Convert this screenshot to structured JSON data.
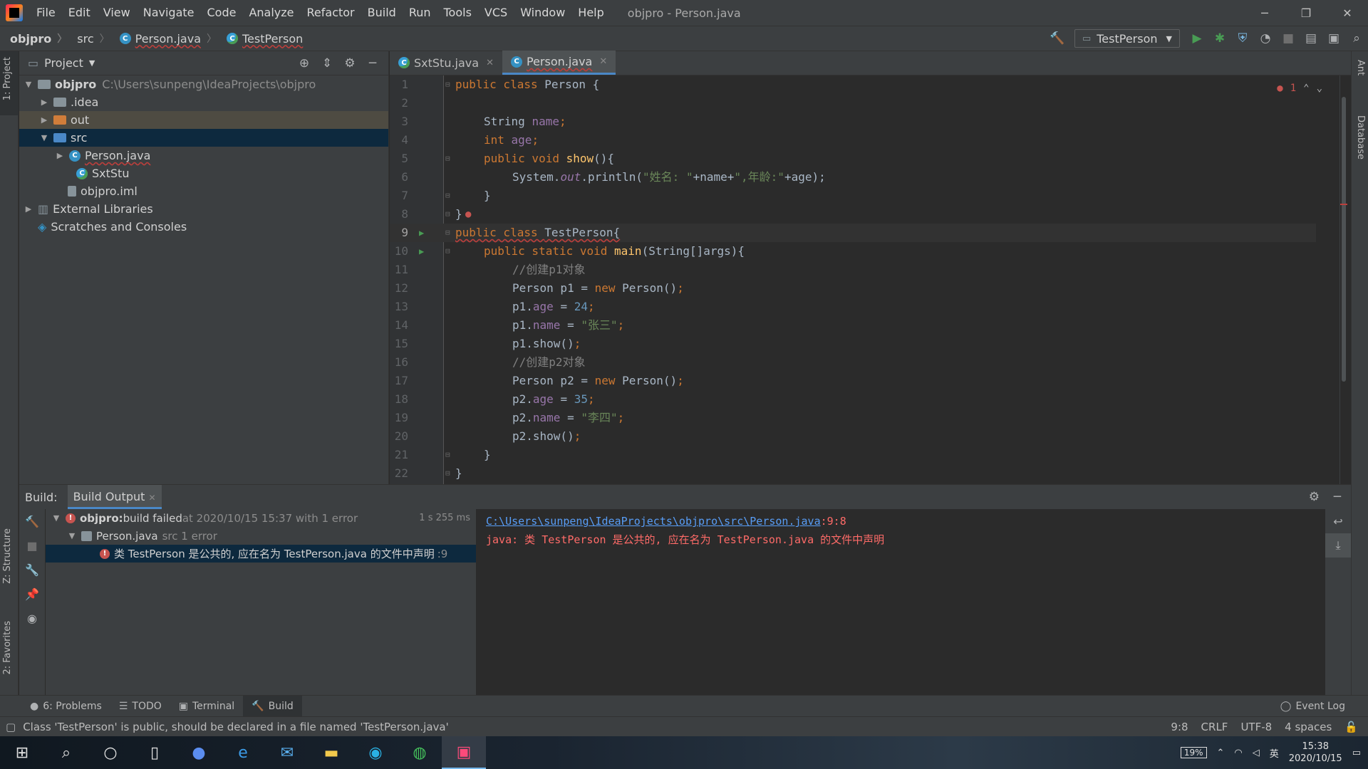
{
  "menu": [
    "File",
    "Edit",
    "View",
    "Navigate",
    "Code",
    "Analyze",
    "Refactor",
    "Build",
    "Run",
    "Tools",
    "VCS",
    "Window",
    "Help"
  ],
  "window_title": "objpro - Person.java",
  "breadcrumbs": [
    "objpro",
    "src",
    "Person.java",
    "TestPerson"
  ],
  "run_config": "TestPerson",
  "project_panel": {
    "title": "Project",
    "tree": [
      {
        "label": "objpro",
        "extra": "C:\\Users\\sunpeng\\IdeaProjects\\objpro"
      },
      {
        "label": ".idea"
      },
      {
        "label": "out"
      },
      {
        "label": "src"
      },
      {
        "label": "Person.java"
      },
      {
        "label": "SxtStu"
      },
      {
        "label": "objpro.iml"
      },
      {
        "label": "External Libraries"
      },
      {
        "label": "Scratches and Consoles"
      }
    ]
  },
  "editor": {
    "tabs": [
      {
        "label": "SxtStu.java"
      },
      {
        "label": "Person.java"
      }
    ],
    "error_count": "1",
    "line_numbers": [
      "1",
      "2",
      "3",
      "4",
      "5",
      "6",
      "7",
      "8",
      "9",
      "10",
      "11",
      "12",
      "13",
      "14",
      "15",
      "16",
      "17",
      "18",
      "19",
      "20",
      "21",
      "22"
    ],
    "code": {
      "l1_kw": "public class ",
      "l1_name": "Person {",
      "l3_type": "String ",
      "l3_field": "name",
      "l3_end": ";",
      "l4_kw": "int ",
      "l4_field": "age",
      "l4_end": ";",
      "l5_kw": "public void ",
      "l5_fn": "show",
      "l5_end": "(){",
      "l6_a": "System.",
      "l6_out": "out",
      "l6_b": ".println(",
      "l6_s1": "\"姓名: \"",
      "l6_c": "+name+",
      "l6_s2": "\",年龄:\"",
      "l6_d": "+age",
      "l6_e": ");",
      "l7": "}",
      "l8": "}",
      "l9_kw": "public class ",
      "l9_name": "TestPerson{",
      "l10_kw": "public static void ",
      "l10_fn": "main",
      "l10_end": "(String[]args){",
      "l11": "//创建p1对象",
      "l12_a": "Person p1 = ",
      "l12_kw": "new ",
      "l12_b": "Person()",
      "l12_end": ";",
      "l13_a": "p1.",
      "l13_f": "age",
      "l13_b": " = ",
      "l13_n": "24",
      "l13_end": ";",
      "l14_a": "p1.",
      "l14_f": "name",
      "l14_b": " = ",
      "l14_s": "\"张三\"",
      "l14_end": ";",
      "l15": "p1.show()",
      "l15_end": ";",
      "l16": "//创建p2对象",
      "l17_a": "Person p2 = ",
      "l17_kw": "new ",
      "l17_b": "Person()",
      "l17_end": ";",
      "l18_a": "p2.",
      "l18_f": "age",
      "l18_b": " = ",
      "l18_n": "35",
      "l18_end": ";",
      "l19_a": "p2.",
      "l19_f": "name",
      "l19_b": " = ",
      "l19_s": "\"李四\"",
      "l19_end": ";",
      "l20": "p2.show()",
      "l20_end": ";",
      "l21": "}",
      "l22": "}"
    }
  },
  "build": {
    "label": "Build:",
    "tab": "Build Output",
    "root_name": "objpro:",
    "root_status": " build failed",
    "root_time": " at 2020/10/15 15:37 with 1 error",
    "root_duration": "1 s 255 ms",
    "file_name": "Person.java",
    "file_extra": "src 1 error",
    "error_msg": "类 TestPerson 是公共的, 应在名为 TestPerson.java 的文件中声明",
    "error_loc": ":9",
    "console_path": "C:\\Users\\sunpeng\\IdeaProjects\\objpro\\src\\Person.java",
    "console_pos": ":9:8",
    "console_error": "java: 类 TestPerson 是公共的, 应在名为 TestPerson.java 的文件中声明"
  },
  "tool_windows": [
    {
      "label": "6: Problems"
    },
    {
      "label": "TODO"
    },
    {
      "label": "Terminal"
    },
    {
      "label": "Build"
    }
  ],
  "event_log": "Event Log",
  "side_tabs": {
    "project": "1: Project",
    "structure": "Z: Structure",
    "favorites": "2: Favorites",
    "ant": "Ant",
    "database": "Database"
  },
  "status": {
    "message": "Class 'TestPerson' is public, should be declared in a file named 'TestPerson.java'",
    "position": "9:8",
    "line_sep": "CRLF",
    "encoding": "UTF-8",
    "indent": "4 spaces"
  },
  "taskbar": {
    "battery": "19%",
    "time": "15:38",
    "date": "2020/10/15",
    "ime": "英"
  },
  "colors": {
    "bg": "#2b2b2b",
    "panel": "#3c3f41",
    "keyword": "#cc7832",
    "string": "#6a8759",
    "number": "#6897bb",
    "error": "#ff6b68",
    "accent": "#4a88c7"
  }
}
